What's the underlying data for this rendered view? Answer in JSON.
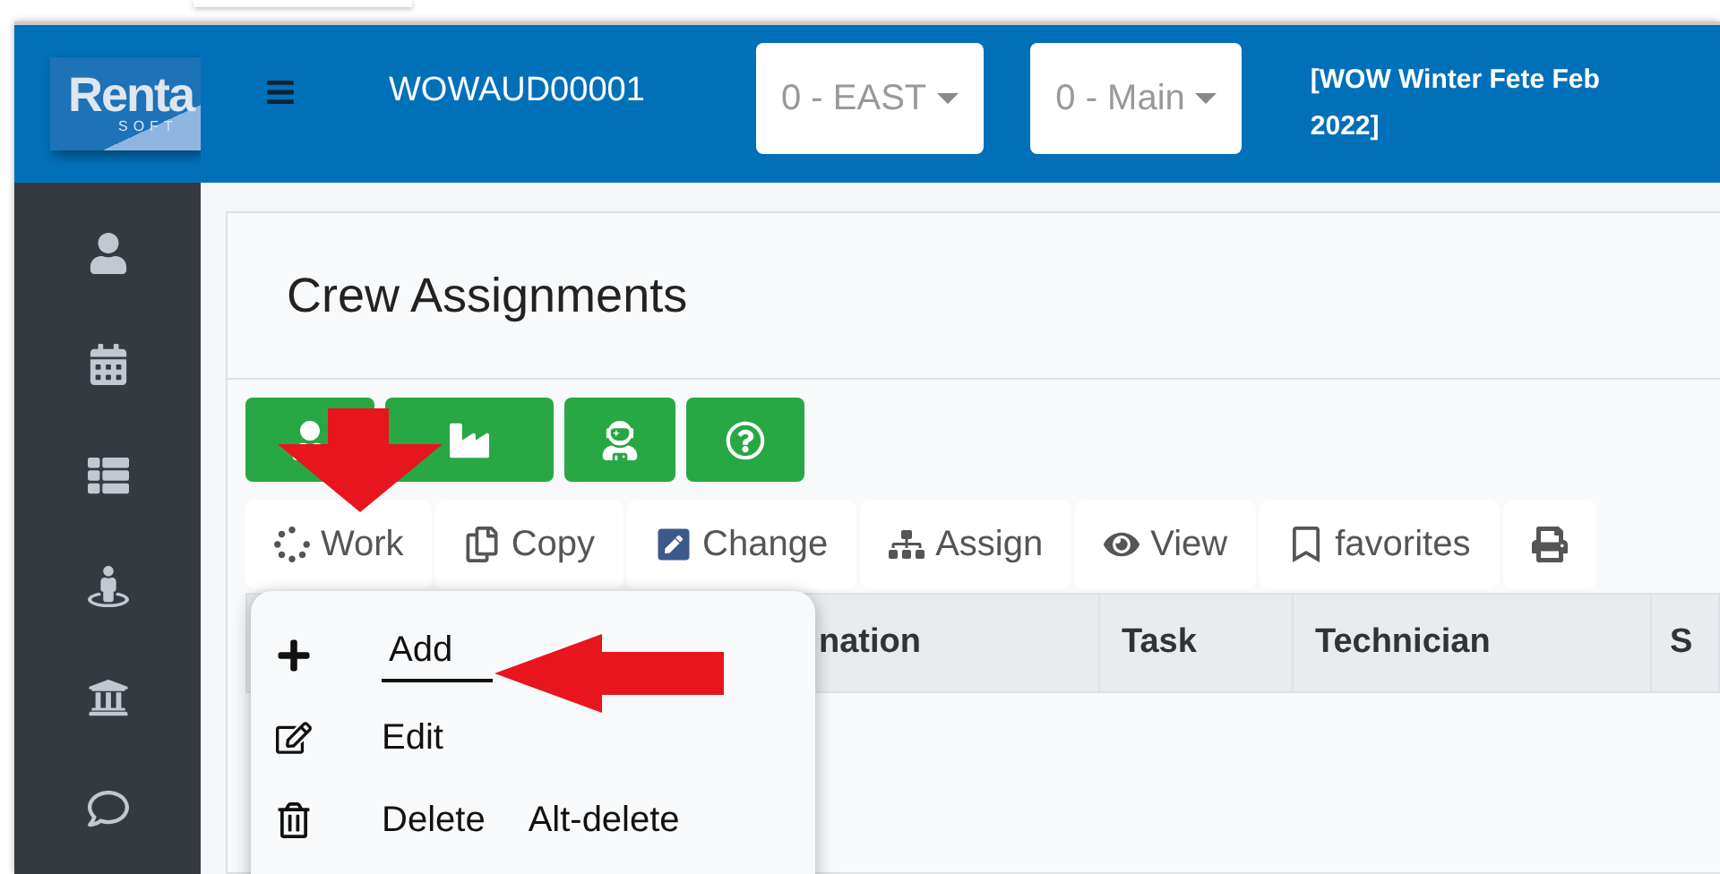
{
  "header": {
    "account": "WOWAUD00001",
    "selects": [
      {
        "value": "0 - EAST"
      },
      {
        "value": "0 - Main"
      }
    ],
    "event": "[WOW Winter Fete Feb 2022]"
  },
  "sidebar": {
    "logo": "Renta",
    "logo_sub": "SOFT"
  },
  "page": {
    "title": "Crew Assignments"
  },
  "menu_bar": [
    {
      "label": "Work",
      "kind": "text"
    },
    {
      "label": "Copy",
      "kind": "text"
    },
    {
      "label": "Change",
      "kind": "text"
    },
    {
      "label": "Assign",
      "kind": "text"
    },
    {
      "label": "View",
      "kind": "text"
    },
    {
      "label": "favorites",
      "kind": "text"
    },
    {
      "kind": "icon"
    }
  ],
  "table": {
    "columns": [
      "nation",
      "Task",
      "Technician",
      "S"
    ]
  },
  "dropdown": [
    {
      "label": "Add",
      "selected": true
    },
    {
      "label": "Edit",
      "selected": false
    },
    {
      "label": "Delete",
      "selected": false,
      "shortcut": "Alt-delete"
    }
  ]
}
